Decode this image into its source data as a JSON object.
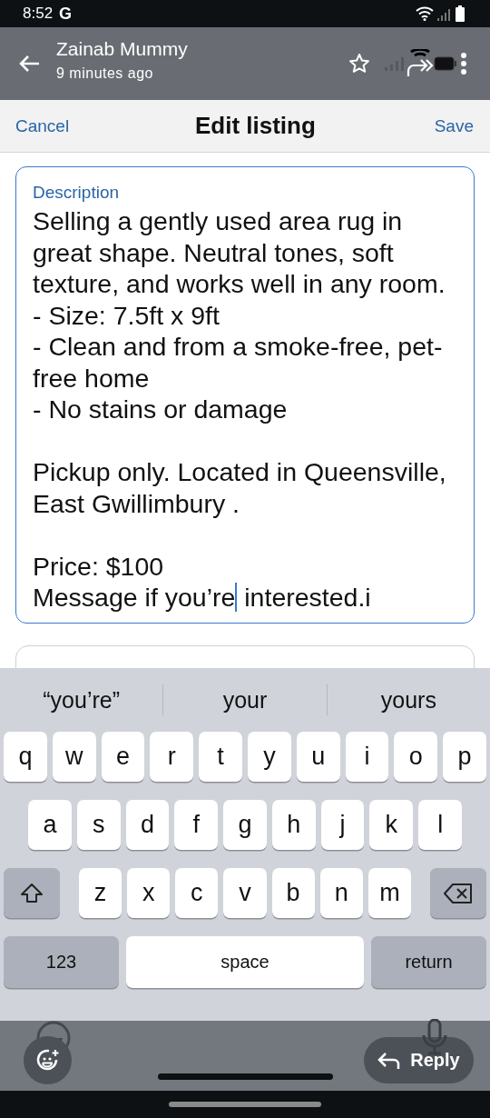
{
  "status_bar": {
    "time": "8:52",
    "app_badge": "G"
  },
  "message_header": {
    "sender": "Zainab Mummy",
    "time_ago": "9 minutes ago",
    "starred": false
  },
  "nav": {
    "cancel": "Cancel",
    "title": "Edit listing",
    "save": "Save"
  },
  "description": {
    "label": "Description",
    "text_before_cursor": "Selling a gently used area rug in great shape. Neutral tones, soft texture, and works well in any room.\n- Size: 7.5ft x 9ft\n- Clean and from a smoke-free, pet-free home\n- No stains or damage\n\nPickup only. Located in Queensville, East Gwillimbury .\n\nPrice: $100\nMessage if you’re",
    "text_after_cursor": " interested.i"
  },
  "suggestions": [
    "“you’re”",
    "your",
    "yours"
  ],
  "keyboard": {
    "rows": [
      [
        "q",
        "w",
        "e",
        "r",
        "t",
        "y",
        "u",
        "i",
        "o",
        "p"
      ],
      [
        "a",
        "s",
        "d",
        "f",
        "g",
        "h",
        "j",
        "k",
        "l"
      ],
      [
        "z",
        "x",
        "c",
        "v",
        "b",
        "n",
        "m"
      ]
    ],
    "numbers": "123",
    "space": "space",
    "return": "return"
  },
  "reply_button": "Reply"
}
